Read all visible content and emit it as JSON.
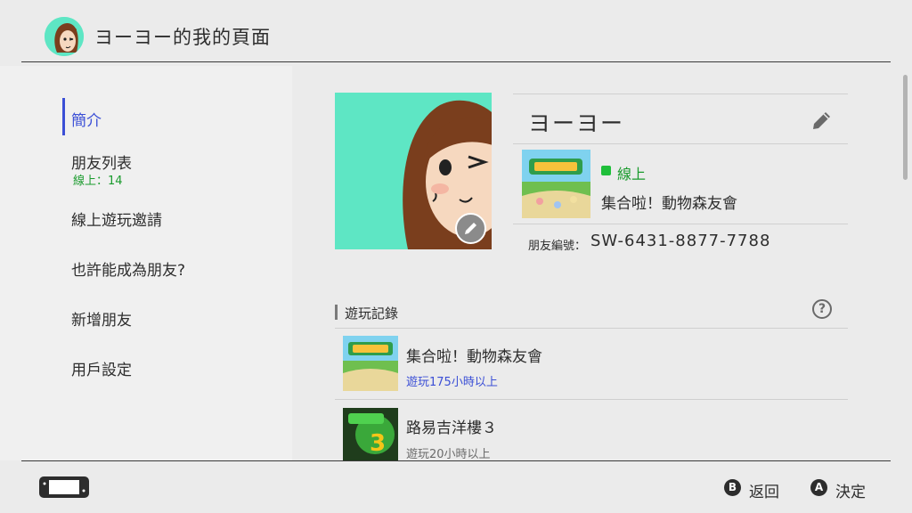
{
  "header": {
    "title": "ヨーヨー的我的頁面",
    "avatar_icon": "mii-avatar-icon"
  },
  "sidebar": {
    "items": [
      {
        "label": "簡介",
        "active": true
      },
      {
        "label": "朋友列表",
        "sub": "線上：14"
      },
      {
        "label": "線上遊玩邀請"
      },
      {
        "label": "也許能成為朋友?"
      },
      {
        "label": "新增朋友"
      },
      {
        "label": "用戶設定"
      }
    ]
  },
  "profile": {
    "name": "ヨーヨー",
    "status": "線上",
    "current_game": "集合啦！動物森友會",
    "friend_code_label": "朋友編號：",
    "friend_code": "SW-6431-8877-7788"
  },
  "play_records": {
    "title": "遊玩記錄",
    "games": [
      {
        "title": "集合啦！動物森友會",
        "playtime": "遊玩175小時以上"
      },
      {
        "title": "路易吉洋樓３",
        "playtime": "遊玩20小時以上"
      }
    ]
  },
  "footer": {
    "back_button": "B",
    "back_label": "返回",
    "confirm_button": "A",
    "confirm_label": "決定"
  },
  "colors": {
    "accent": "#3b4fd6",
    "online": "#1fbf3a",
    "mii_background": "#5ee6c4"
  }
}
